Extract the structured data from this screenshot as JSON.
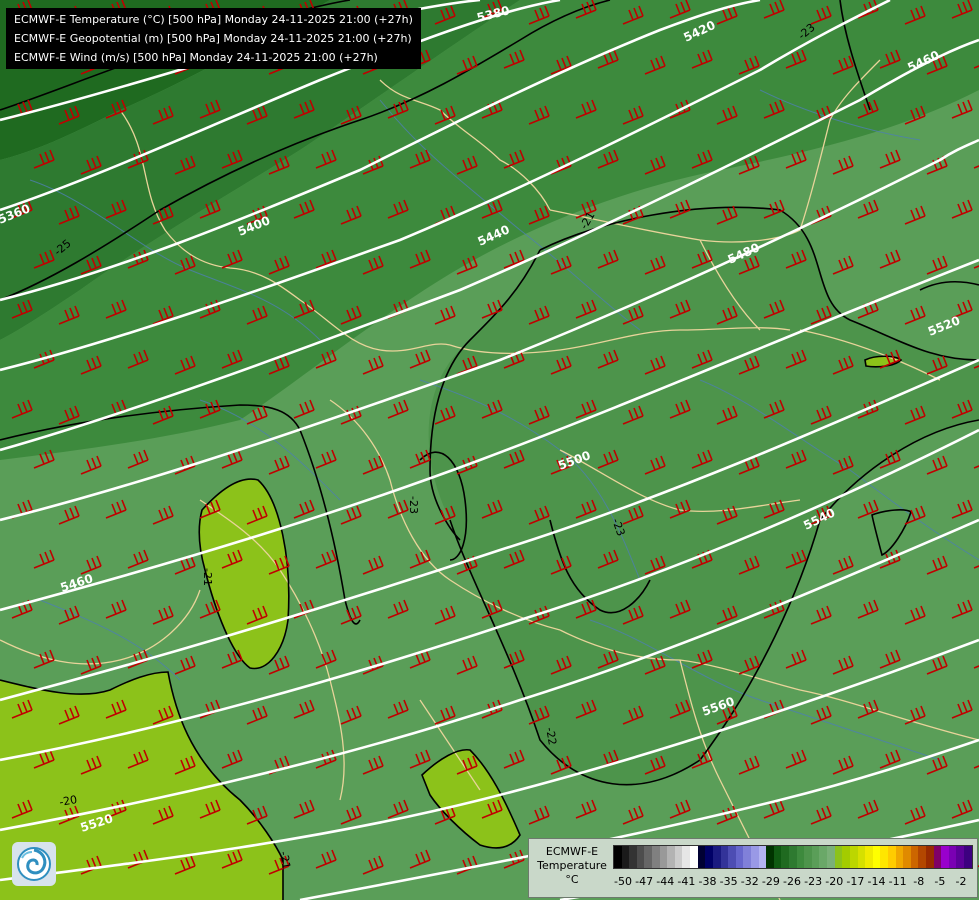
{
  "header": {
    "lines": [
      "ECMWF-E Temperature (°C) [500 hPa] Monday 24-11-2025 21:00 (+27h)",
      "ECMWF-E Geopotential (m) [500 hPa] Monday 24-11-2025 21:00 (+27h)",
      "ECMWF-E Wind (m/s) [500 hPa] Monday 24-11-2025 21:00 (+27h)"
    ]
  },
  "map": {
    "geopotential_contours": [
      {
        "value": "5380",
        "label": "5380"
      },
      {
        "value": "5360",
        "label": "5360"
      },
      {
        "value": "5400",
        "label": "5400"
      },
      {
        "value": "5420",
        "label": "5420"
      },
      {
        "value": "5440",
        "label": "5440"
      },
      {
        "value": "5460",
        "label": "5460"
      },
      {
        "value": "5460b",
        "label": "5460"
      },
      {
        "value": "5480",
        "label": "5480"
      },
      {
        "value": "5500",
        "label": "5500"
      },
      {
        "value": "5520",
        "label": "5520"
      },
      {
        "value": "5520b",
        "label": "5520"
      },
      {
        "value": "5540",
        "label": "5540"
      },
      {
        "value": "5560",
        "label": "5560"
      }
    ],
    "temperature_labels": [
      "-23",
      "-25",
      "-21",
      "-23",
      "-21",
      "-22",
      "-20",
      "-21",
      "-23"
    ],
    "colors": {
      "temp_-29": "#0f5a12",
      "temp_-27": "#2e7a30",
      "temp_-25": "#3d8a3d",
      "temp_-23": "#4d944b",
      "temp_-22": "#5a9e58",
      "temp_-21": "#8cc21a",
      "wind_barb": "#c00000",
      "geopotential": "#ffffff",
      "isotherm": "#000000",
      "border": "#e8d49a",
      "river": "#4d7fb0"
    }
  },
  "legend": {
    "title_line1": "ECMWF-E",
    "title_line2": "Temperature",
    "title_line3": "°C",
    "ticks": [
      "-50",
      "-47",
      "-44",
      "-41",
      "-38",
      "-35",
      "-32",
      "-29",
      "-26",
      "-23",
      "-20",
      "-17",
      "-14",
      "-11",
      "-8",
      "-5",
      "-2"
    ],
    "swatches": [
      "#000000",
      "#1a1a1a",
      "#333333",
      "#4d4d4d",
      "#666666",
      "#808080",
      "#999999",
      "#b3b3b3",
      "#cccccc",
      "#e6e6e6",
      "#ffffff",
      "#000033",
      "#000066",
      "#1a1a80",
      "#333399",
      "#4d4db3",
      "#6666cc",
      "#8080d9",
      "#9999e6",
      "#b3b3f2",
      "#003300",
      "#0f5a12",
      "#1f6a20",
      "#2e7a30",
      "#3d8a3d",
      "#4d944b",
      "#5a9e58",
      "#6aa868",
      "#7ab078",
      "#8cc21a",
      "#a3cc00",
      "#bcd600",
      "#d6e000",
      "#f0eb00",
      "#ffff00",
      "#ffe600",
      "#ffcc00",
      "#f0a800",
      "#e08a00",
      "#cc6600",
      "#b34700",
      "#992b00",
      "#800066",
      "#9900cc",
      "#7a00b3",
      "#5c0099",
      "#3d0080"
    ],
    "logo_name": "logo-swirl"
  }
}
